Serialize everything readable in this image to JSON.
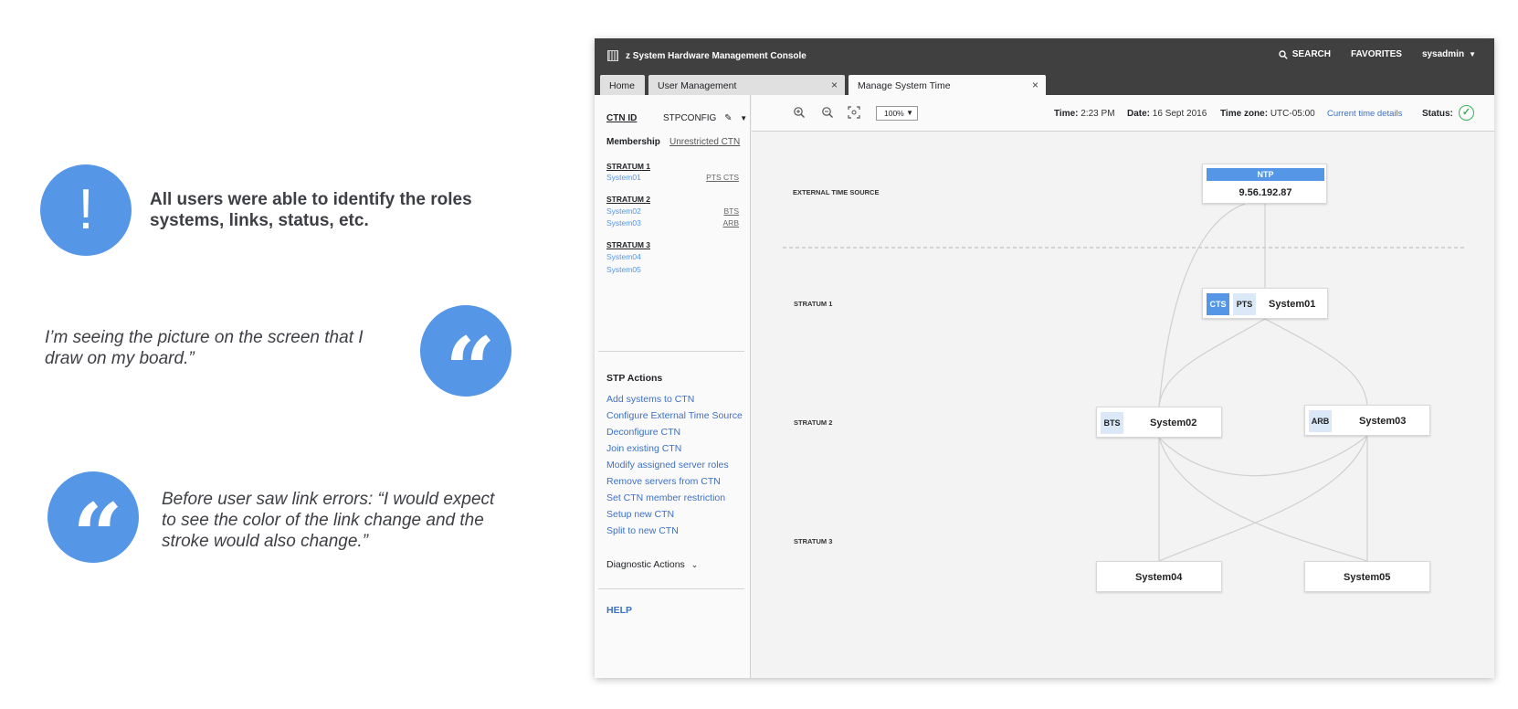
{
  "notes": [
    {
      "icon": "exclamation-icon",
      "text": "All users were able to identify the roles systems, links, status, etc."
    },
    {
      "icon": "quote-icon",
      "text": "I’m seeing the picture on the screen that I draw on my board.”"
    },
    {
      "icon": "quote-icon",
      "text": "Before user saw link errors: “I would expect to see the color of the link change and the stroke would also change.”"
    }
  ],
  "app": {
    "title": "z System Hardware Management Console",
    "nav": {
      "search": "SEARCH",
      "favorites": "FAVORITES",
      "user": "sysadmin"
    },
    "tabs": [
      {
        "label": "Home"
      },
      {
        "label": "User Management"
      },
      {
        "label": "Manage System Time"
      }
    ]
  },
  "sidebar": {
    "ctn_label": "CTN ID",
    "ctn_value": "STPCONFIG",
    "membership_label": "Membership",
    "membership_value": "Unrestricted CTN",
    "strata": [
      {
        "heading": "STRATUM 1",
        "systems": [
          {
            "name": "System01",
            "roles": "PTS  CTS"
          }
        ]
      },
      {
        "heading": "STRATUM 2",
        "systems": [
          {
            "name": "System02",
            "roles": "BTS"
          },
          {
            "name": "System03",
            "roles": "ARB"
          }
        ]
      },
      {
        "heading": "STRATUM 3",
        "systems": [
          {
            "name": "System04",
            "roles": ""
          },
          {
            "name": "System05",
            "roles": ""
          }
        ]
      }
    ],
    "actions_heading": "STP Actions",
    "actions": [
      "Add systems to CTN",
      "Configure External Time Source",
      "Deconfigure CTN",
      "Join existing CTN",
      "Modify assigned server roles",
      "Remove servers from CTN",
      "Set CTN member restriction",
      "Setup new CTN",
      "Split to new CTN"
    ],
    "diagnostic": "Diagnostic Actions",
    "help": "HELP"
  },
  "toolbar": {
    "zoom": "100%",
    "time_label": "Time:",
    "time_value": "2:23 PM",
    "date_label": "Date:",
    "date_value": "16 Sept 2016",
    "tz_label": "Time zone:",
    "tz_value": "UTC-05:00",
    "details_link": "Current time details",
    "status_label": "Status:",
    "status_icon": "check-circle-icon"
  },
  "topology": {
    "labels": {
      "external": "EXTERNAL TIME SOURCE",
      "stratum1": "STRATUM 1",
      "stratum2": "STRATUM 2",
      "stratum3": "STRATUM 3"
    },
    "ntp": {
      "title": "NTP",
      "address": "9.56.192.87"
    },
    "nodes": {
      "system01": {
        "name": "System01",
        "badges": [
          "CTS",
          "PTS"
        ]
      },
      "system02": {
        "name": "System02",
        "badges": [
          "BTS"
        ]
      },
      "system03": {
        "name": "System03",
        "badges": [
          "ARB"
        ]
      },
      "system04": {
        "name": "System04",
        "badges": []
      },
      "system05": {
        "name": "System05",
        "badges": []
      }
    }
  },
  "colors": {
    "accent": "#5596e6",
    "topbar": "#404040",
    "link": "#3d70c4",
    "status_ok": "#3bae5a"
  }
}
